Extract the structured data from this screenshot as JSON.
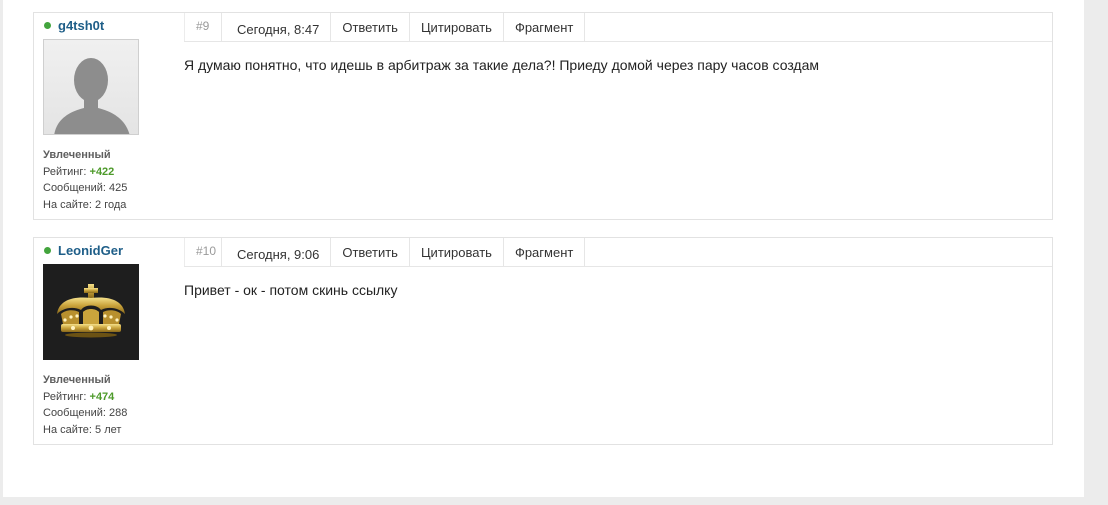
{
  "posts": [
    {
      "number": "#9",
      "author": "g4tsh0t",
      "user_title": "Увлеченный",
      "rating_label": "Рейтинг:",
      "rating_value": "+422",
      "messages_label": "Сообщений:",
      "messages_value": "425",
      "site_label": "На сайте:",
      "site_value": "2 года",
      "date": "Сегодня, 8:47",
      "reply_label": "Ответить",
      "quote_label": "Цитировать",
      "fragment_label": "Фрагмент",
      "text": "Я думаю понятно, что идешь в арбитраж за такие дела?! Приеду домой через пару часов создам"
    },
    {
      "number": "#10",
      "author": "LeonidGer",
      "user_title": "Увлеченный",
      "rating_label": "Рейтинг:",
      "rating_value": "+474",
      "messages_label": "Сообщений:",
      "messages_value": "288",
      "site_label": "На сайте:",
      "site_value": "5 лет",
      "date": "Сегодня, 9:06",
      "reply_label": "Ответить",
      "quote_label": "Цитировать",
      "fragment_label": "Фрагмент",
      "text": "Привет - ок - потом скинь ссылку"
    }
  ],
  "colors": {
    "online": "#43a43d",
    "username": "#1e5e88",
    "rating": "#4d9a2a"
  },
  "icons": {
    "post1_avatar": "default-avatar-silhouette",
    "post2_avatar": "gold-crown-avatar"
  }
}
